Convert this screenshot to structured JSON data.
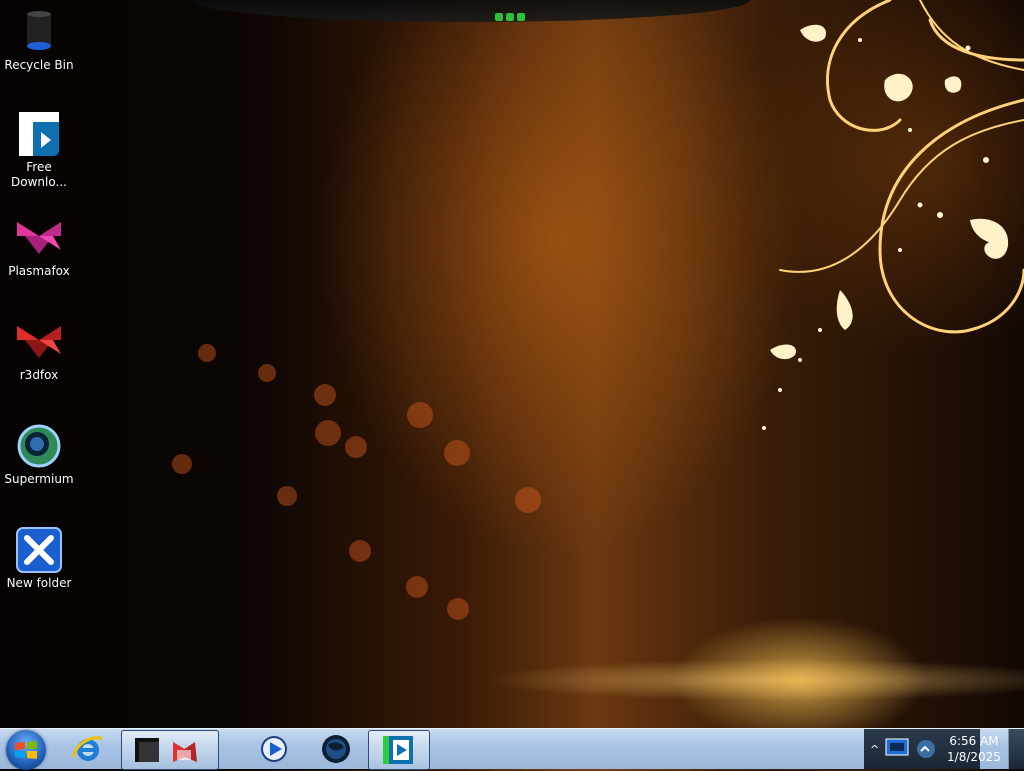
{
  "desktop": {
    "icons": [
      {
        "label": "Recycle Bin",
        "icon": "recycle-bin-icon"
      },
      {
        "label": "Free\nDownlo...",
        "icon": "free-download-manager-icon"
      },
      {
        "label": "Plasmafox",
        "icon": "plasmafox-icon"
      },
      {
        "label": "r3dfox",
        "icon": "r3dfox-icon"
      },
      {
        "label": "Supermium",
        "icon": "supermium-icon"
      },
      {
        "label": "New folder",
        "icon": "new-folder-icon"
      }
    ]
  },
  "taskbar": {
    "pinned": [
      {
        "name": "internet-explorer",
        "icon": "internet-explorer-icon"
      },
      {
        "name": "terminal-group",
        "icon": "terminal-icon"
      },
      {
        "name": "media-player",
        "icon": "media-player-icon"
      },
      {
        "name": "supermium-app",
        "icon": "globe-icon"
      },
      {
        "name": "free-download-manager-app",
        "icon": "free-download-manager-icon"
      }
    ],
    "tray_expand_label": "^",
    "clock": {
      "time": "6:56 AM",
      "date": "1/8/2025"
    }
  },
  "colors": {
    "taskbar": "#a9c4e4",
    "wallpaper_accent": "#6b3810",
    "start_orb": "#1f5fb8"
  }
}
